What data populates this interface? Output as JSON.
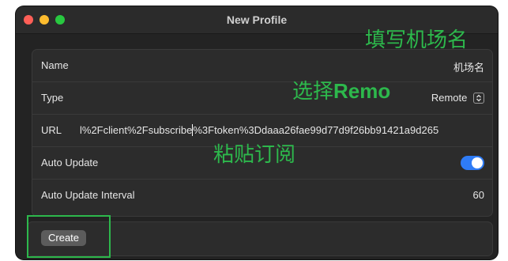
{
  "window": {
    "title": "New Profile"
  },
  "form": {
    "name": {
      "label": "Name",
      "value": "机场名"
    },
    "type": {
      "label": "Type",
      "value": "Remote"
    },
    "url": {
      "label": "URL",
      "value_before_caret": "l%2Fclient%2Fsubscribe",
      "value_after_caret": "%3Ftoken%3Ddaaa26fae99d77d9f26bb91421a9d265"
    },
    "auto_update": {
      "label": "Auto Update",
      "enabled": true
    },
    "auto_update_interval": {
      "label": "Auto Update Interval",
      "value": "60"
    }
  },
  "footer": {
    "create_label": "Create"
  },
  "annotations": {
    "name_hint": "填写机场名",
    "type_hint_prefix": "选择",
    "type_hint_bold": "Remo",
    "url_hint": "粘贴订阅"
  },
  "colors": {
    "annotation_green": "#2db84c",
    "toggle_blue": "#2f7cf6",
    "window_bg": "#232323"
  },
  "icons": {
    "type_select": "chevron-up-down-icon",
    "traffic_lights": [
      "close-dot",
      "minimize-dot",
      "zoom-dot"
    ]
  }
}
